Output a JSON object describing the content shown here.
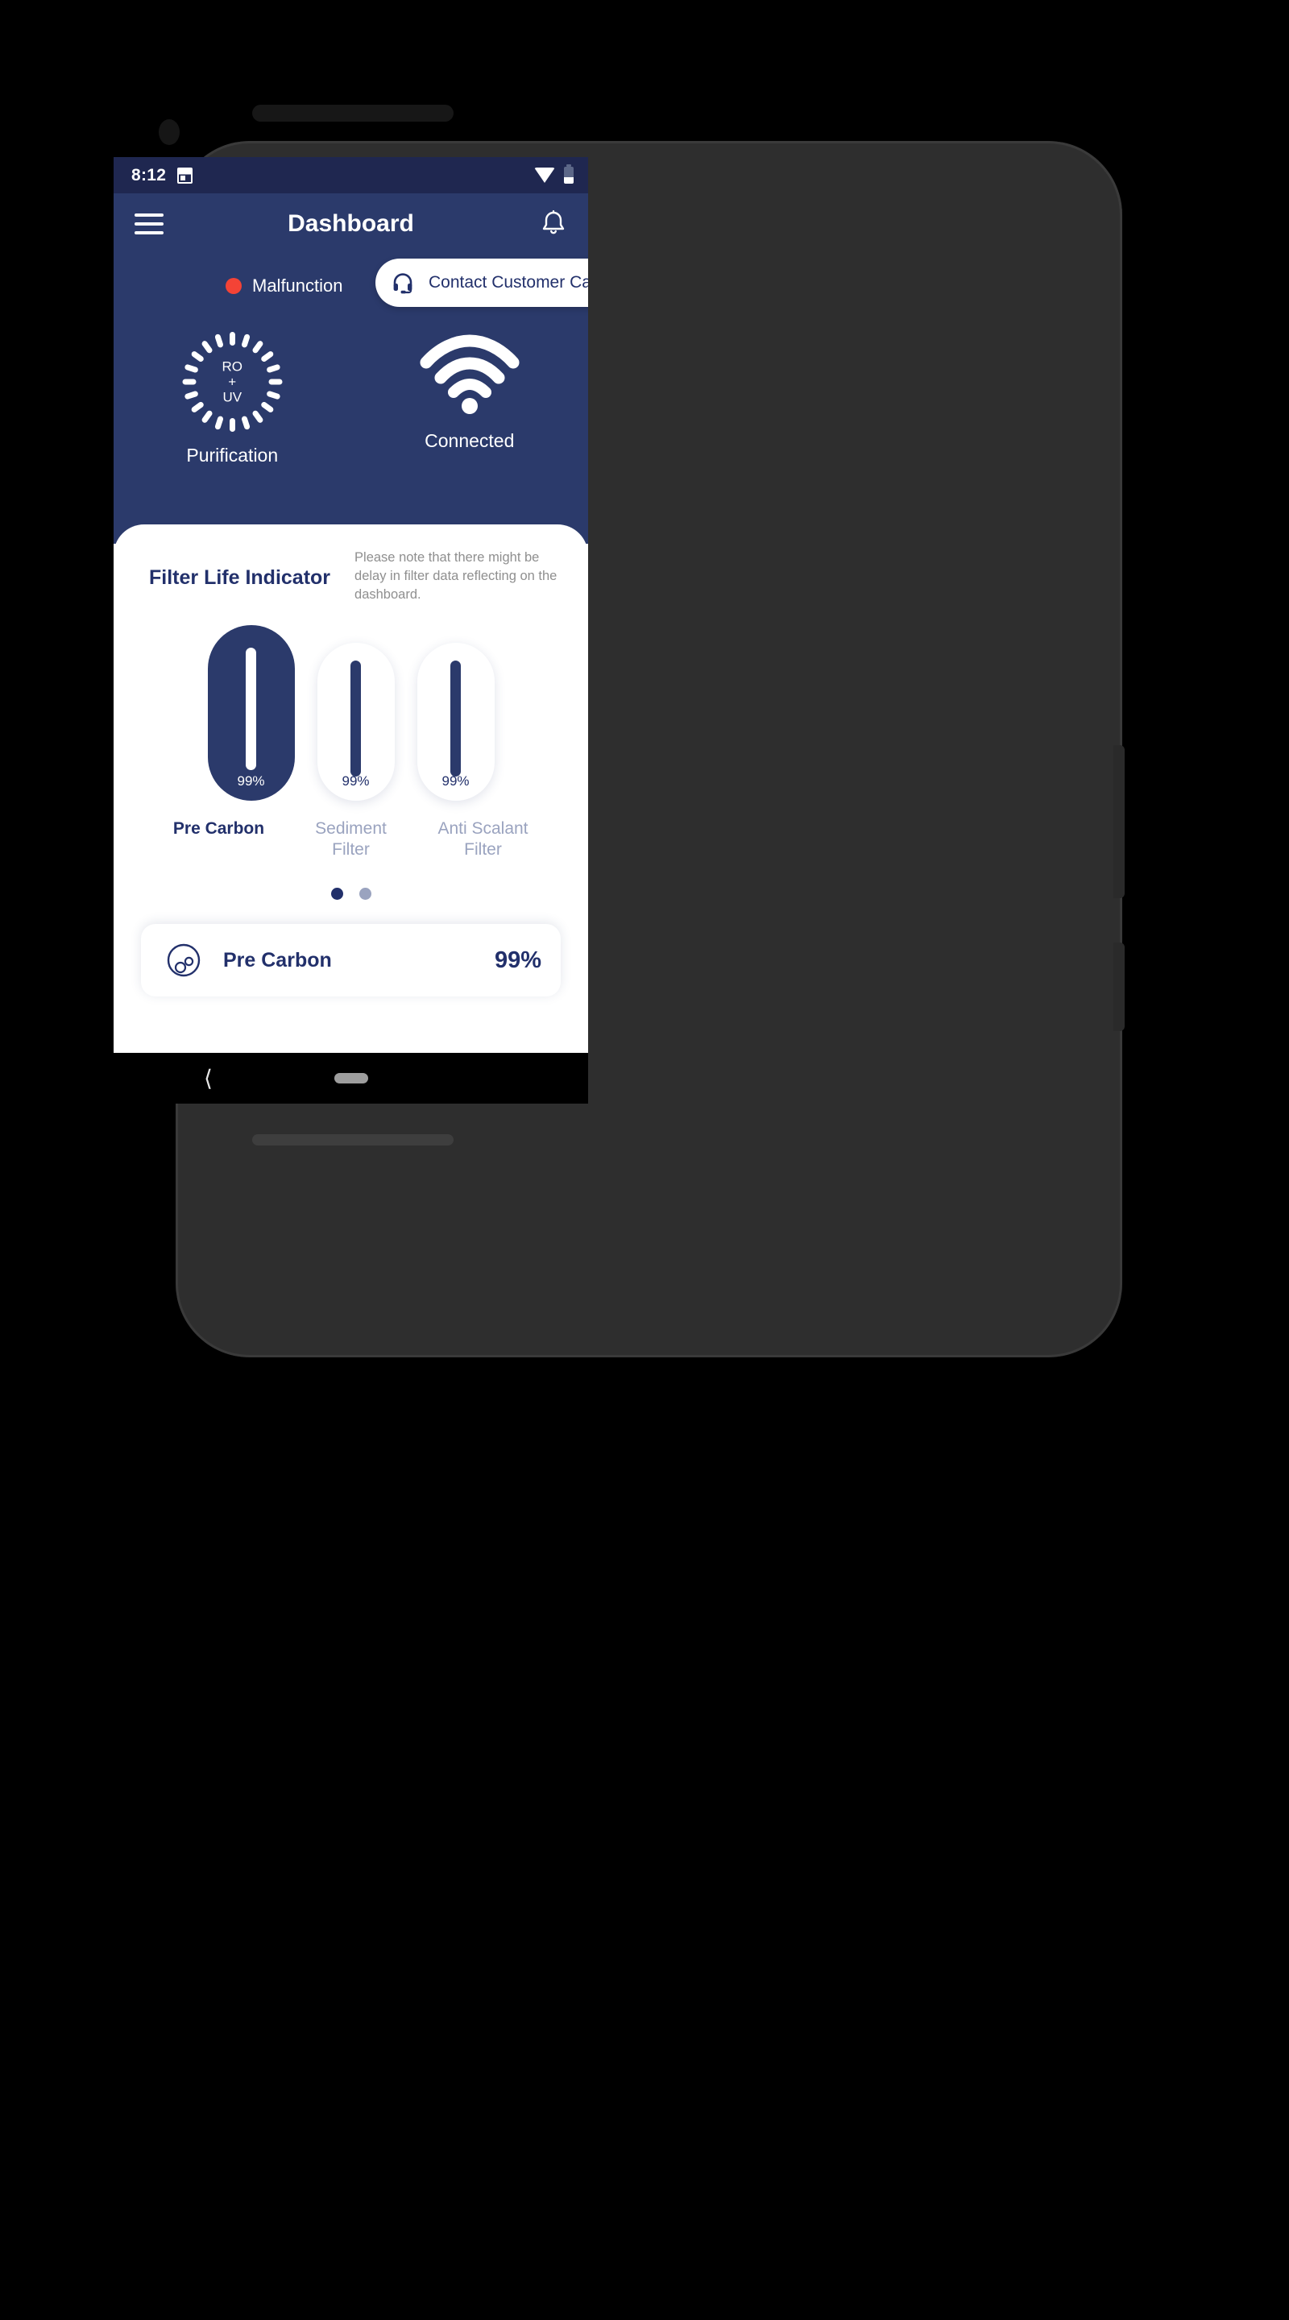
{
  "status_bar": {
    "time": "8:12",
    "icons": [
      "calendar-icon",
      "wifi-icon",
      "battery-icon"
    ]
  },
  "app_bar": {
    "title": "Dashboard",
    "menu_icon": "hamburger-menu-icon",
    "notification_icon": "bell-icon"
  },
  "device_status": {
    "malfunction_label": "Malfunction",
    "malfunction_color": "#f44336",
    "customer_care_label": "Contact Customer Care",
    "customer_care_icon": "headset-icon"
  },
  "modes": [
    {
      "icon": "purification-ring-icon",
      "icon_text_line1": "RO",
      "icon_text_line2": "+",
      "icon_text_line3": "UV",
      "label": "Purification"
    },
    {
      "icon": "wifi-icon",
      "label": "Connected"
    }
  ],
  "filter_section": {
    "title": "Filter Life Indicator",
    "note": "Please note that there might be delay in filter data reflecting on the dashboard.",
    "filters": [
      {
        "name": "Pre Carbon",
        "percent": "99%",
        "value": 99,
        "active": true
      },
      {
        "name": "Sediment Filter",
        "percent": "99%",
        "value": 99,
        "active": false
      },
      {
        "name": "Anti Scalant Filter",
        "percent": "99%",
        "value": 99,
        "active": false
      }
    ],
    "pagination": {
      "total": 2,
      "current": 1
    }
  },
  "detail_card": {
    "icon": "filter-particles-icon",
    "name": "Pre Carbon",
    "percent": "99%"
  },
  "nav_bar": {
    "back_icon": "back-chevron-icon",
    "home_icon": "home-pill-icon"
  },
  "theme": {
    "header_navy": "#2b3a6b",
    "status_navy": "#1f2750",
    "text_navy": "#22306b",
    "muted_blue": "#9aa3bf",
    "alert_red": "#f44336"
  }
}
